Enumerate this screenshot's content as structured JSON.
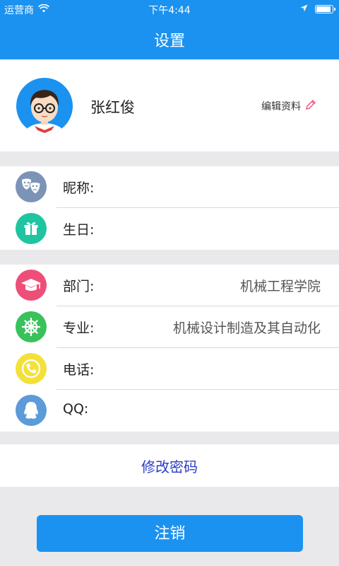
{
  "status": {
    "carrier": "运营商",
    "time": "下午4:44"
  },
  "header": {
    "title": "设置"
  },
  "profile": {
    "name": "张红俊",
    "edit_label": "编辑资料"
  },
  "group1": [
    {
      "label": "昵称:",
      "value": "",
      "icon": "masks-icon",
      "color": "#7b93b6"
    },
    {
      "label": "生日:",
      "value": "",
      "icon": "gift-icon",
      "color": "#1fc5a0"
    }
  ],
  "group2": [
    {
      "label": "部门:",
      "value": "机械工程学院",
      "icon": "graduation-cap-icon",
      "color": "#ee4f79"
    },
    {
      "label": "专业:",
      "value": "机械设计制造及其自动化",
      "icon": "ship-wheel-icon",
      "color": "#39c25b"
    },
    {
      "label": "电话:",
      "value": "",
      "icon": "phone-icon",
      "color": "#f4e03a"
    },
    {
      "label": "QQ:",
      "value": "",
      "icon": "qq-penguin-icon",
      "color": "#5b9bd9"
    }
  ],
  "actions": {
    "change_password": "修改密码",
    "logout": "注销"
  },
  "colors": {
    "primary": "#1b92f0",
    "link": "#2b3cc9",
    "background": "#e9e9ec"
  }
}
